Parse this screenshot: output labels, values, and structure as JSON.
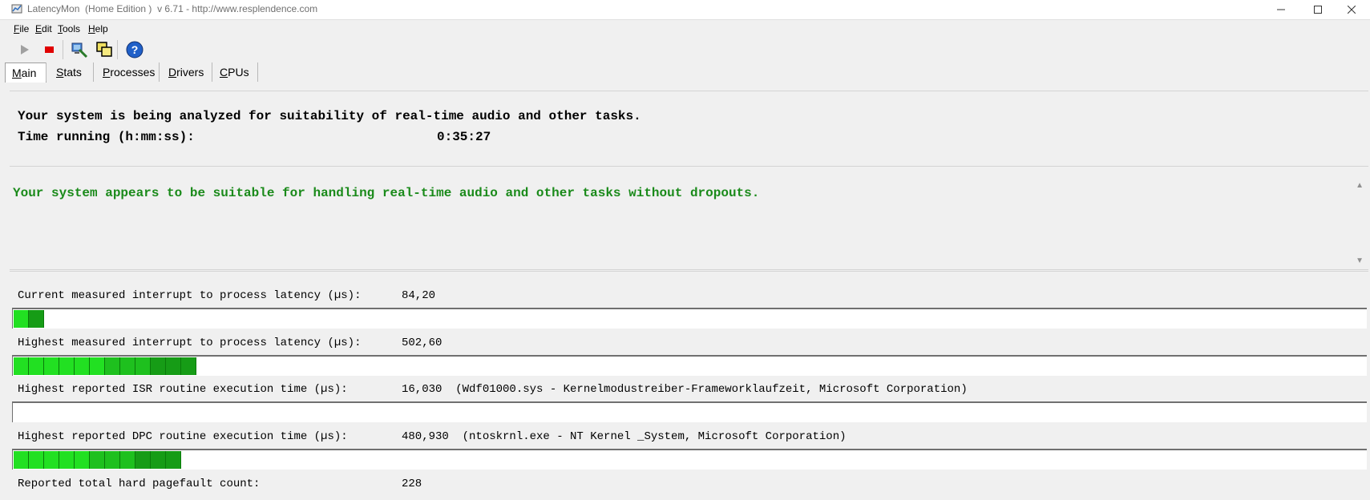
{
  "window": {
    "title": "LatencyMon  (Home Edition )  v 6.71 - http://www.resplendence.com"
  },
  "menu": [
    {
      "label": "File",
      "accel": "F",
      "rest": "ile"
    },
    {
      "label": "Edit",
      "accel": "E",
      "rest": "dit"
    },
    {
      "label": "Tools",
      "accel": "T",
      "rest": "ools"
    },
    {
      "label": "Help",
      "accel": "H",
      "rest": "elp"
    }
  ],
  "tabs": [
    {
      "label": "Main",
      "accel": "M",
      "rest": "ain",
      "selected": true
    },
    {
      "label": "Stats",
      "accel": "S",
      "rest": "tats"
    },
    {
      "label": "Processes",
      "accel": "P",
      "rest": "rocesses"
    },
    {
      "label": "Drivers",
      "accel": "D",
      "rest": "rivers"
    },
    {
      "label": "CPUs",
      "accel": "C",
      "rest": "PUs"
    }
  ],
  "summary": {
    "analyzing": "Your system is being analyzed for suitability of real-time audio and other tasks.",
    "time_label": "Time running (h:mm:ss):",
    "time_value": "0:35:27"
  },
  "status": {
    "message": "Your system appears to be suitable for handling real-time audio and other tasks without dropouts.",
    "color": "#1a8a1a"
  },
  "metrics": [
    {
      "label": "Current measured interrupt to process latency (µs):",
      "value": "84,20",
      "segments": 2
    },
    {
      "label": "Highest measured interrupt to process latency (µs):",
      "value": "502,60",
      "segments": 12
    },
    {
      "label": "Highest reported ISR routine execution time (µs):",
      "value": "16,030  (Wdf01000.sys - Kernelmodustreiber-Frameworklaufzeit, Microsoft Corporation)",
      "segments": 0
    },
    {
      "label": "Highest reported DPC routine execution time (µs):",
      "value": "480,930  (ntoskrnl.exe - NT Kernel _System, Microsoft Corporation)",
      "segments": 11
    },
    {
      "label": "Reported total hard pagefault count:",
      "value": "228"
    }
  ],
  "toolbar": {
    "buttons": [
      "play-icon",
      "stop-icon",
      "analyze-icon",
      "windows-icon",
      "help-icon"
    ]
  },
  "colors": {
    "bar_bright": "#22e022",
    "bar_dark": "#169c16",
    "status_green": "#1a8a1a"
  }
}
